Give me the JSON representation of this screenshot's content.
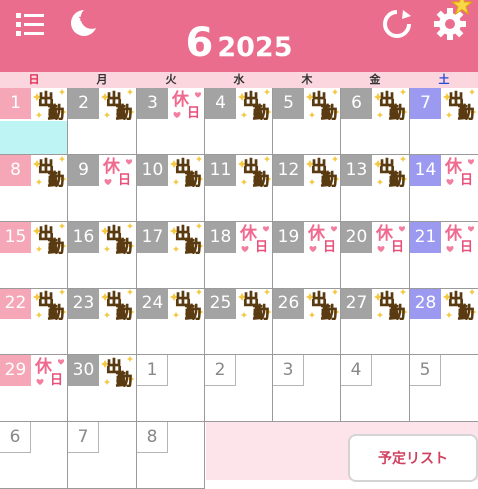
{
  "header": {
    "month": "6",
    "year": "2025",
    "icons": [
      "menu-icon",
      "moon-star-icon",
      "refresh-icon",
      "gear-icon",
      "star-badge-icon"
    ]
  },
  "weekdays": [
    "日",
    "月",
    "火",
    "水",
    "木",
    "金",
    "土"
  ],
  "colors": {
    "header": "#ea6d8e",
    "weekday_row": "#fbd6de",
    "day_number": "#a3a3a3",
    "sunday": "#f6a7b7",
    "saturday": "#9c9af0",
    "today_highlight": "#bff4f5",
    "bottom_pane": "#fde4ea"
  },
  "stamps": {
    "work": [
      "出",
      "勤"
    ],
    "off": [
      "休",
      "日"
    ]
  },
  "days": [
    {
      "day": "1",
      "stamp": "work",
      "type": "sun",
      "today": true
    },
    {
      "day": "2",
      "stamp": "work",
      "type": "weekday"
    },
    {
      "day": "3",
      "stamp": "off",
      "type": "weekday"
    },
    {
      "day": "4",
      "stamp": "work",
      "type": "weekday"
    },
    {
      "day": "5",
      "stamp": "work",
      "type": "weekday"
    },
    {
      "day": "6",
      "stamp": "work",
      "type": "weekday"
    },
    {
      "day": "7",
      "stamp": "work",
      "type": "sat"
    },
    {
      "day": "8",
      "stamp": "work",
      "type": "sun"
    },
    {
      "day": "9",
      "stamp": "off",
      "type": "weekday"
    },
    {
      "day": "10",
      "stamp": "work",
      "type": "weekday"
    },
    {
      "day": "11",
      "stamp": "work",
      "type": "weekday"
    },
    {
      "day": "12",
      "stamp": "work",
      "type": "weekday"
    },
    {
      "day": "13",
      "stamp": "work",
      "type": "weekday"
    },
    {
      "day": "14",
      "stamp": "off",
      "type": "sat"
    },
    {
      "day": "15",
      "stamp": "work",
      "type": "sun"
    },
    {
      "day": "16",
      "stamp": "work",
      "type": "weekday"
    },
    {
      "day": "17",
      "stamp": "work",
      "type": "weekday"
    },
    {
      "day": "18",
      "stamp": "off",
      "type": "weekday"
    },
    {
      "day": "19",
      "stamp": "off",
      "type": "weekday"
    },
    {
      "day": "20",
      "stamp": "off",
      "type": "weekday"
    },
    {
      "day": "21",
      "stamp": "off",
      "type": "sat"
    },
    {
      "day": "22",
      "stamp": "work",
      "type": "sun"
    },
    {
      "day": "23",
      "stamp": "work",
      "type": "weekday"
    },
    {
      "day": "24",
      "stamp": "work",
      "type": "weekday"
    },
    {
      "day": "25",
      "stamp": "work",
      "type": "weekday"
    },
    {
      "day": "26",
      "stamp": "work",
      "type": "weekday"
    },
    {
      "day": "27",
      "stamp": "work",
      "type": "weekday"
    },
    {
      "day": "28",
      "stamp": "work",
      "type": "sat"
    },
    {
      "day": "29",
      "stamp": "off",
      "type": "sun"
    },
    {
      "day": "30",
      "stamp": "work",
      "type": "weekday"
    },
    {
      "day": "1",
      "stamp": "",
      "type": "out"
    },
    {
      "day": "2",
      "stamp": "",
      "type": "out"
    },
    {
      "day": "3",
      "stamp": "",
      "type": "out"
    },
    {
      "day": "4",
      "stamp": "",
      "type": "out"
    },
    {
      "day": "5",
      "stamp": "",
      "type": "out"
    },
    {
      "day": "6",
      "stamp": "",
      "type": "out"
    },
    {
      "day": "7",
      "stamp": "",
      "type": "out"
    },
    {
      "day": "8",
      "stamp": "",
      "type": "out"
    }
  ],
  "schedule_button": "予定リスト"
}
